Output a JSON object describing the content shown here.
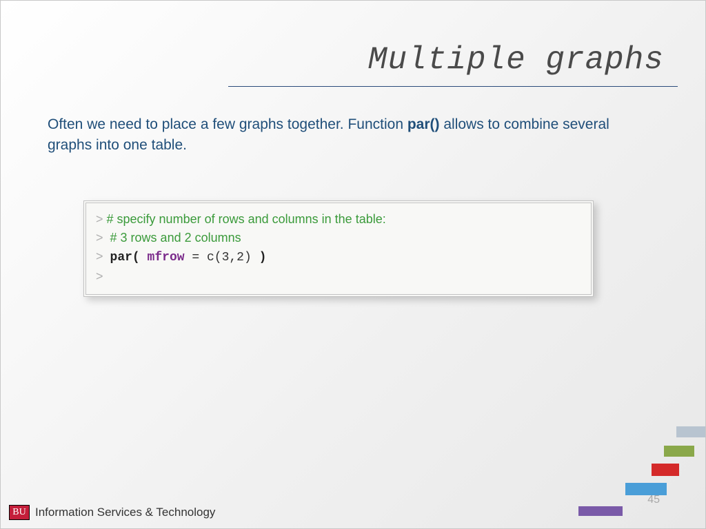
{
  "title": "Multiple graphs",
  "body": {
    "pre": "Often we need to place a few graphs together. Function ",
    "fn": "par()",
    "post": " allows to combine several graphs into one table."
  },
  "code": {
    "prompt": ">",
    "line1_comment": " # specify number of rows and columns in the table:",
    "line2_comment": "# 3 rows and 2 columns",
    "line3_a": "par( ",
    "line3_arg": "mfrow",
    "line3_b": " = c(3,2) ",
    "line3_c": ")"
  },
  "footer": {
    "logo_text": "BU",
    "org": "Information Services & Technology"
  },
  "page_number": "45",
  "bars_colors": {
    "b1": "#b8c4d0",
    "b2": "#8aa84a",
    "b3": "#d42a2a",
    "b4": "#4a9ed8",
    "b5": "#7a5aa8"
  }
}
